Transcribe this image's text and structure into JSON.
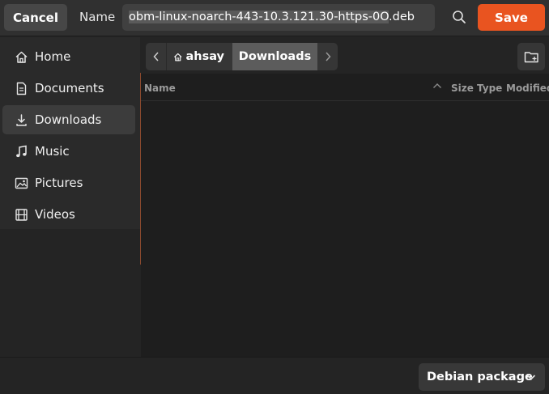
{
  "header": {
    "cancel_label": "Cancel",
    "name_label": "Name",
    "filename_selected": "obm-linux-noarch-443-10.3.121.30-https-0O",
    "filename_ext": ".deb",
    "save_label": "Save",
    "accent_color": "#e95420"
  },
  "sidebar": {
    "items": [
      {
        "label": "Home",
        "icon": "home-icon"
      },
      {
        "label": "Documents",
        "icon": "document-icon"
      },
      {
        "label": "Downloads",
        "icon": "download-icon",
        "active": true
      },
      {
        "label": "Music",
        "icon": "music-icon"
      },
      {
        "label": "Pictures",
        "icon": "picture-icon"
      },
      {
        "label": "Videos",
        "icon": "video-icon"
      }
    ]
  },
  "pathbar": {
    "segments": [
      {
        "label": "ahsay",
        "icon": "home-icon"
      },
      {
        "label": "Downloads",
        "current": true
      }
    ]
  },
  "filelist": {
    "columns": [
      "Name",
      "Size",
      "Type",
      "Modified"
    ],
    "rows": []
  },
  "footer": {
    "filter_label": "Debian package"
  }
}
